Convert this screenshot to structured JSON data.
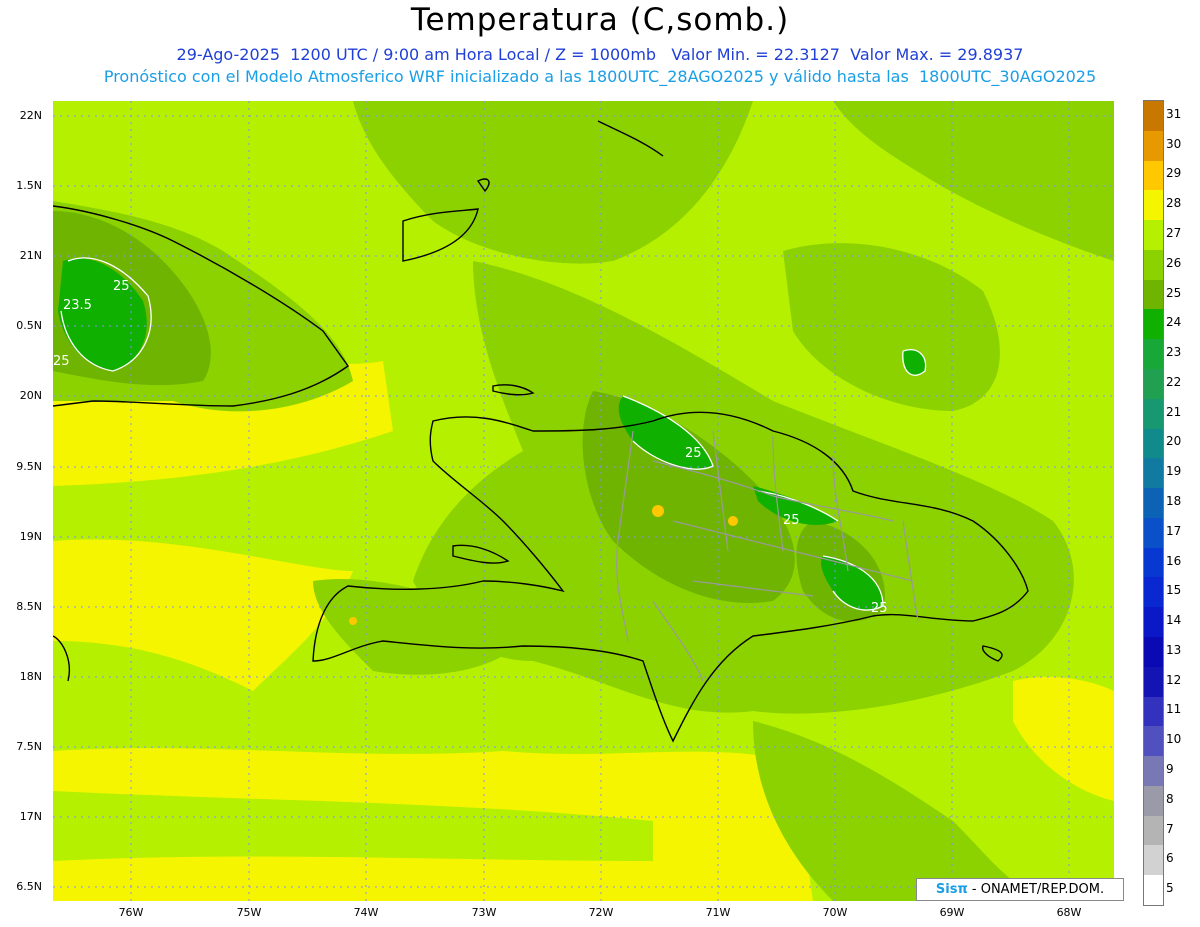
{
  "header": {
    "title": "Temperatura (C,somb.)",
    "line1": "29-Ago-2025  1200 UTC / 9:00 am Hora Local / Z = 1000mb   Valor Min. = 22.3127  Valor Max. = 29.8937",
    "line2": "Pronóstico con el Modelo Atmosferico WRF inicializado a las 1800UTC_28AGO2025 y válido hasta las  1800UTC_30AGO2025"
  },
  "axes": {
    "lat_labels": [
      "22N",
      "1.5N",
      "21N",
      "0.5N",
      "20N",
      "9.5N",
      "19N",
      "8.5N",
      "18N",
      "7.5N",
      "17N",
      "6.5N"
    ],
    "lon_labels": [
      "76W",
      "75W",
      "74W",
      "73W",
      "72W",
      "71W",
      "70W",
      "69W",
      "68W"
    ]
  },
  "contour_labels": [
    "23.5",
    "25",
    "25",
    "25",
    "25",
    "25"
  ],
  "credit": {
    "logo": "Sisπ",
    "text": " - ONAMET/REP.DOM."
  },
  "legend": {
    "labels": [
      "31",
      "30",
      "29",
      "28",
      "27",
      "26",
      "25",
      "24",
      "23",
      "22",
      "21",
      "20",
      "19",
      "18",
      "17",
      "16",
      "15",
      "14",
      "13",
      "12",
      "11",
      "10",
      "9",
      "8",
      "7",
      "6",
      "5"
    ],
    "colors": [
      "#c87800",
      "#e69a00",
      "#ffc800",
      "#f5f500",
      "#b4f000",
      "#8cd200",
      "#6eb400",
      "#10b000",
      "#18a838",
      "#20a050",
      "#189870",
      "#108a8a",
      "#107aa0",
      "#0c62b4",
      "#0a50c8",
      "#0838d2",
      "#0a28d2",
      "#0a18c8",
      "#0a0ab4",
      "#1414b4",
      "#3232be",
      "#5050be",
      "#7878b4",
      "#9a9aa8",
      "#b4b4b4",
      "#d2d2d2",
      "#ffffff"
    ]
  },
  "colors": {
    "t28": "#f5f500",
    "t27": "#b4f000",
    "t26": "#8cd200",
    "t25": "#6eb400",
    "t24": "#10b000",
    "t29": "#ffc800",
    "coast": "#000000",
    "border": "#9a9a9a",
    "grid": "#8a8aff"
  }
}
